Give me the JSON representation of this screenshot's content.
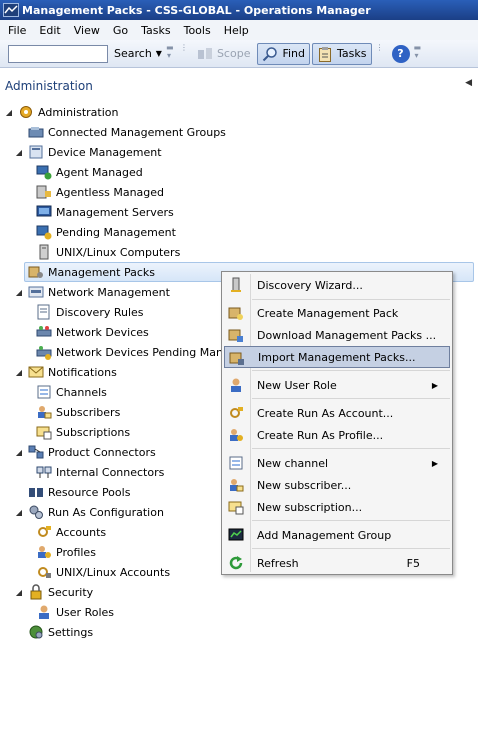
{
  "window": {
    "title": "Management Packs - CSS-GLOBAL - Operations Manager"
  },
  "menu": [
    "File",
    "Edit",
    "View",
    "Go",
    "Tasks",
    "Tools",
    "Help"
  ],
  "toolbar": {
    "search_value": "",
    "search_label": "Search",
    "scope_label": "Scope",
    "find_label": "Find",
    "tasks_label": "Tasks",
    "help_glyph": "?"
  },
  "pane": {
    "title": "Administration"
  },
  "tree": [
    {
      "label": "Administration",
      "icon": "admin-gear-icon"
    },
    {
      "label": "Connected Management Groups",
      "icon": "connected-groups-icon"
    },
    {
      "label": "Device Management",
      "icon": "device-management-icon"
    },
    {
      "label": "Agent Managed",
      "icon": "agent-managed-icon"
    },
    {
      "label": "Agentless Managed",
      "icon": "agentless-managed-icon"
    },
    {
      "label": "Management Servers",
      "icon": "management-servers-icon"
    },
    {
      "label": "Pending Management",
      "icon": "pending-management-icon"
    },
    {
      "label": "UNIX/Linux Computers",
      "icon": "unix-computers-icon"
    },
    {
      "label": "Management Packs",
      "icon": "management-packs-icon"
    },
    {
      "label": "Network Management",
      "icon": "network-management-icon"
    },
    {
      "label": "Discovery Rules",
      "icon": "discovery-rules-icon"
    },
    {
      "label": "Network Devices",
      "icon": "network-devices-icon"
    },
    {
      "label": "Network Devices Pending Manag",
      "icon": "network-pending-icon"
    },
    {
      "label": "Notifications",
      "icon": "notifications-icon"
    },
    {
      "label": "Channels",
      "icon": "channels-icon"
    },
    {
      "label": "Subscribers",
      "icon": "subscribers-icon"
    },
    {
      "label": "Subscriptions",
      "icon": "subscriptions-icon"
    },
    {
      "label": "Product Connectors",
      "icon": "product-connectors-icon"
    },
    {
      "label": "Internal Connectors",
      "icon": "internal-connectors-icon"
    },
    {
      "label": "Resource Pools",
      "icon": "resource-pools-icon"
    },
    {
      "label": "Run As Configuration",
      "icon": "run-as-config-icon"
    },
    {
      "label": "Accounts",
      "icon": "accounts-icon"
    },
    {
      "label": "Profiles",
      "icon": "profiles-icon"
    },
    {
      "label": "UNIX/Linux Accounts",
      "icon": "unix-accounts-icon"
    },
    {
      "label": "Security",
      "icon": "security-lock-icon"
    },
    {
      "label": "User Roles",
      "icon": "user-roles-icon"
    },
    {
      "label": "Settings",
      "icon": "settings-icon"
    }
  ],
  "context_menu": [
    {
      "label": "Discovery Wizard...",
      "icon": "discovery-wizard-icon"
    },
    {
      "label": "Create Management Pack",
      "icon": "create-mp-icon"
    },
    {
      "label": "Download Management Packs ...",
      "icon": "download-mp-icon"
    },
    {
      "label": "Import Management Packs...",
      "icon": "import-mp-icon"
    },
    {
      "label": "New User Role",
      "icon": "new-user-role-icon"
    },
    {
      "label": "Create Run As Account...",
      "icon": "run-as-account-icon"
    },
    {
      "label": "Create Run As Profile...",
      "icon": "run-as-profile-icon"
    },
    {
      "label": "New channel",
      "icon": "new-channel-icon"
    },
    {
      "label": "New subscriber...",
      "icon": "new-subscriber-icon"
    },
    {
      "label": "New subscription...",
      "icon": "new-subscription-icon"
    },
    {
      "label": "Add Management Group",
      "icon": "add-management-group-icon"
    },
    {
      "label": "Refresh",
      "icon": "refresh-icon",
      "shortcut": "F5"
    }
  ]
}
